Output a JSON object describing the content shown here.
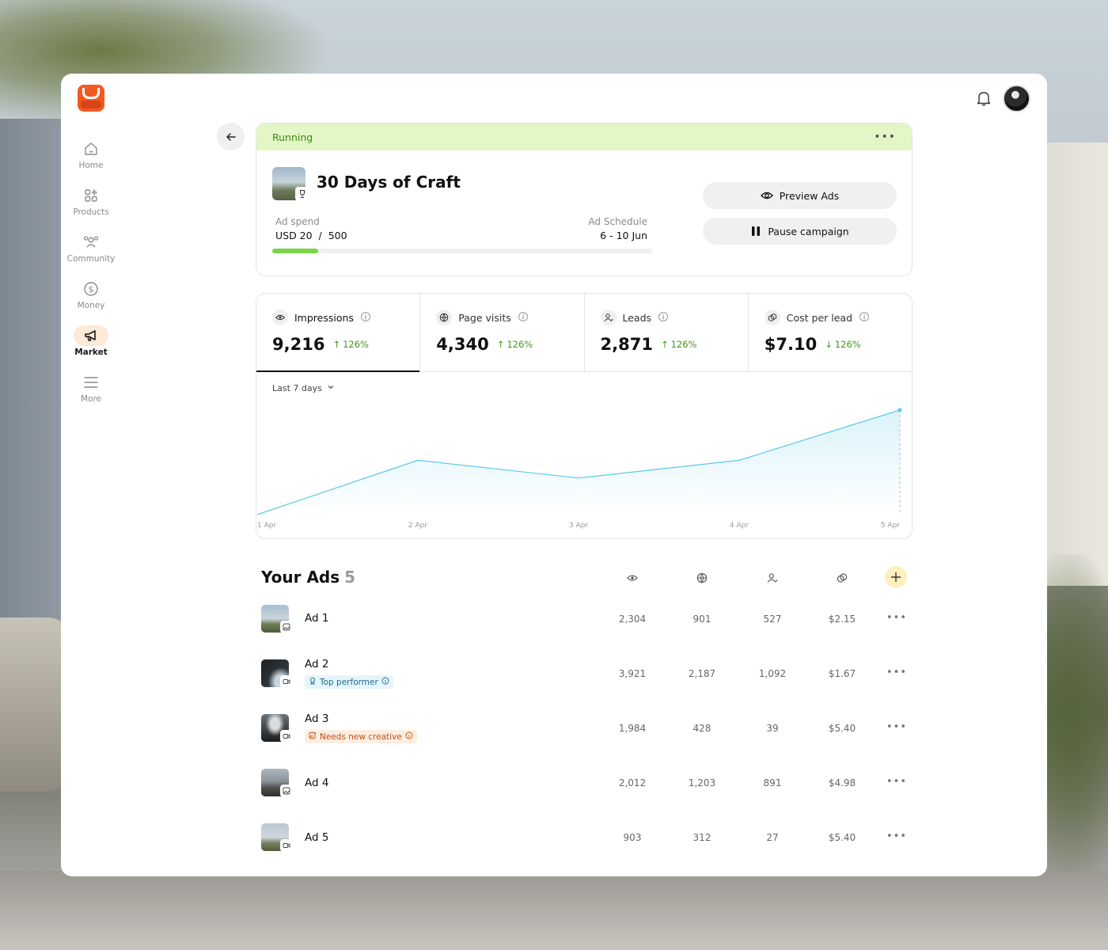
{
  "sidebar": {
    "items": [
      {
        "label": "Home",
        "icon": "home-icon"
      },
      {
        "label": "Products",
        "icon": "grid-icon"
      },
      {
        "label": "Community",
        "icon": "people-icon"
      },
      {
        "label": "Money",
        "icon": "dollar-icon"
      },
      {
        "label": "Market",
        "icon": "megaphone-icon",
        "active": true
      },
      {
        "label": "More",
        "icon": "menu-icon"
      }
    ]
  },
  "campaign": {
    "status": "Running",
    "title": "30 Days of Craft",
    "ad_spend_label": "Ad spend",
    "ad_spend_value": "USD 20  /  500",
    "ad_spend_progress": 0.12,
    "schedule_label": "Ad Schedule",
    "schedule_value": "6 - 10 Jun",
    "preview_button": "Preview Ads",
    "pause_button": "Pause campaign"
  },
  "metrics": [
    {
      "label": "Impressions",
      "value": "9,216",
      "change": "126%",
      "direction": "up",
      "active": true
    },
    {
      "label": "Page visits",
      "value": "4,340",
      "change": "126%",
      "direction": "up"
    },
    {
      "label": "Leads",
      "value": "2,871",
      "change": "126%",
      "direction": "up"
    },
    {
      "label": "Cost per lead",
      "value": "$7.10",
      "change": "126%",
      "direction": "down"
    }
  ],
  "range": "Last 7 days",
  "chart_data": {
    "type": "area",
    "categories": [
      "1 Apr",
      "2 Apr",
      "3 Apr",
      "4 Apr",
      "5 Apr"
    ],
    "values": [
      0,
      0.52,
      0.35,
      0.52,
      1.0
    ],
    "color": "#5bc8ea"
  },
  "ads": {
    "title": "Your Ads",
    "count": "5",
    "rows": [
      {
        "name": "Ad 1",
        "type": "image",
        "impressions": "2,304",
        "visits": "901",
        "leads": "527",
        "cpl": "$2.15",
        "badge": ""
      },
      {
        "name": "Ad 2",
        "type": "video",
        "impressions": "3,921",
        "visits": "2,187",
        "leads": "1,092",
        "cpl": "$1.67",
        "badge": "Top performer",
        "badge_kind": "top"
      },
      {
        "name": "Ad 3",
        "type": "video",
        "impressions": "1,984",
        "visits": "428",
        "leads": "39",
        "cpl": "$5.40",
        "badge": "Needs new creative",
        "badge_kind": "warn"
      },
      {
        "name": "Ad 4",
        "type": "image",
        "impressions": "2,012",
        "visits": "1,203",
        "leads": "891",
        "cpl": "$4.98",
        "badge": ""
      },
      {
        "name": "Ad 5",
        "type": "video",
        "impressions": "903",
        "visits": "312",
        "leads": "27",
        "cpl": "$5.40",
        "badge": ""
      }
    ]
  },
  "colors": {
    "accent": "#f25a22",
    "status_bg": "#e3f7c6",
    "status_text": "#3d8a12",
    "up": "#3d9a15",
    "chart": "#5bc8ea"
  }
}
